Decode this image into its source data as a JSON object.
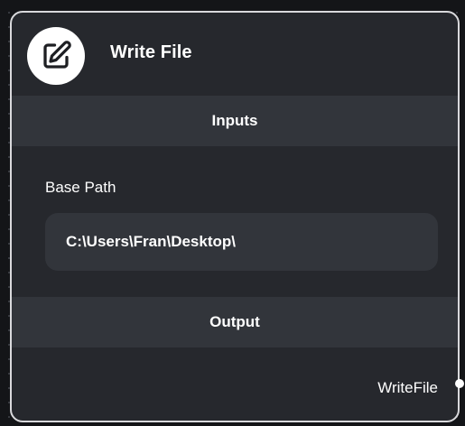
{
  "node": {
    "title": "Write File",
    "icon": "edit-square-icon"
  },
  "inputs": {
    "section_label": "Inputs",
    "base_path": {
      "label": "Base Path",
      "value": "C:\\Users\\Fran\\Desktop\\"
    }
  },
  "output": {
    "section_label": "Output",
    "port_label": "WriteFile"
  },
  "colors": {
    "canvas": "#141518",
    "node_body": "#26282d",
    "section_band": "#32353b",
    "border": "#d9d9dc",
    "text": "#ffffff"
  }
}
